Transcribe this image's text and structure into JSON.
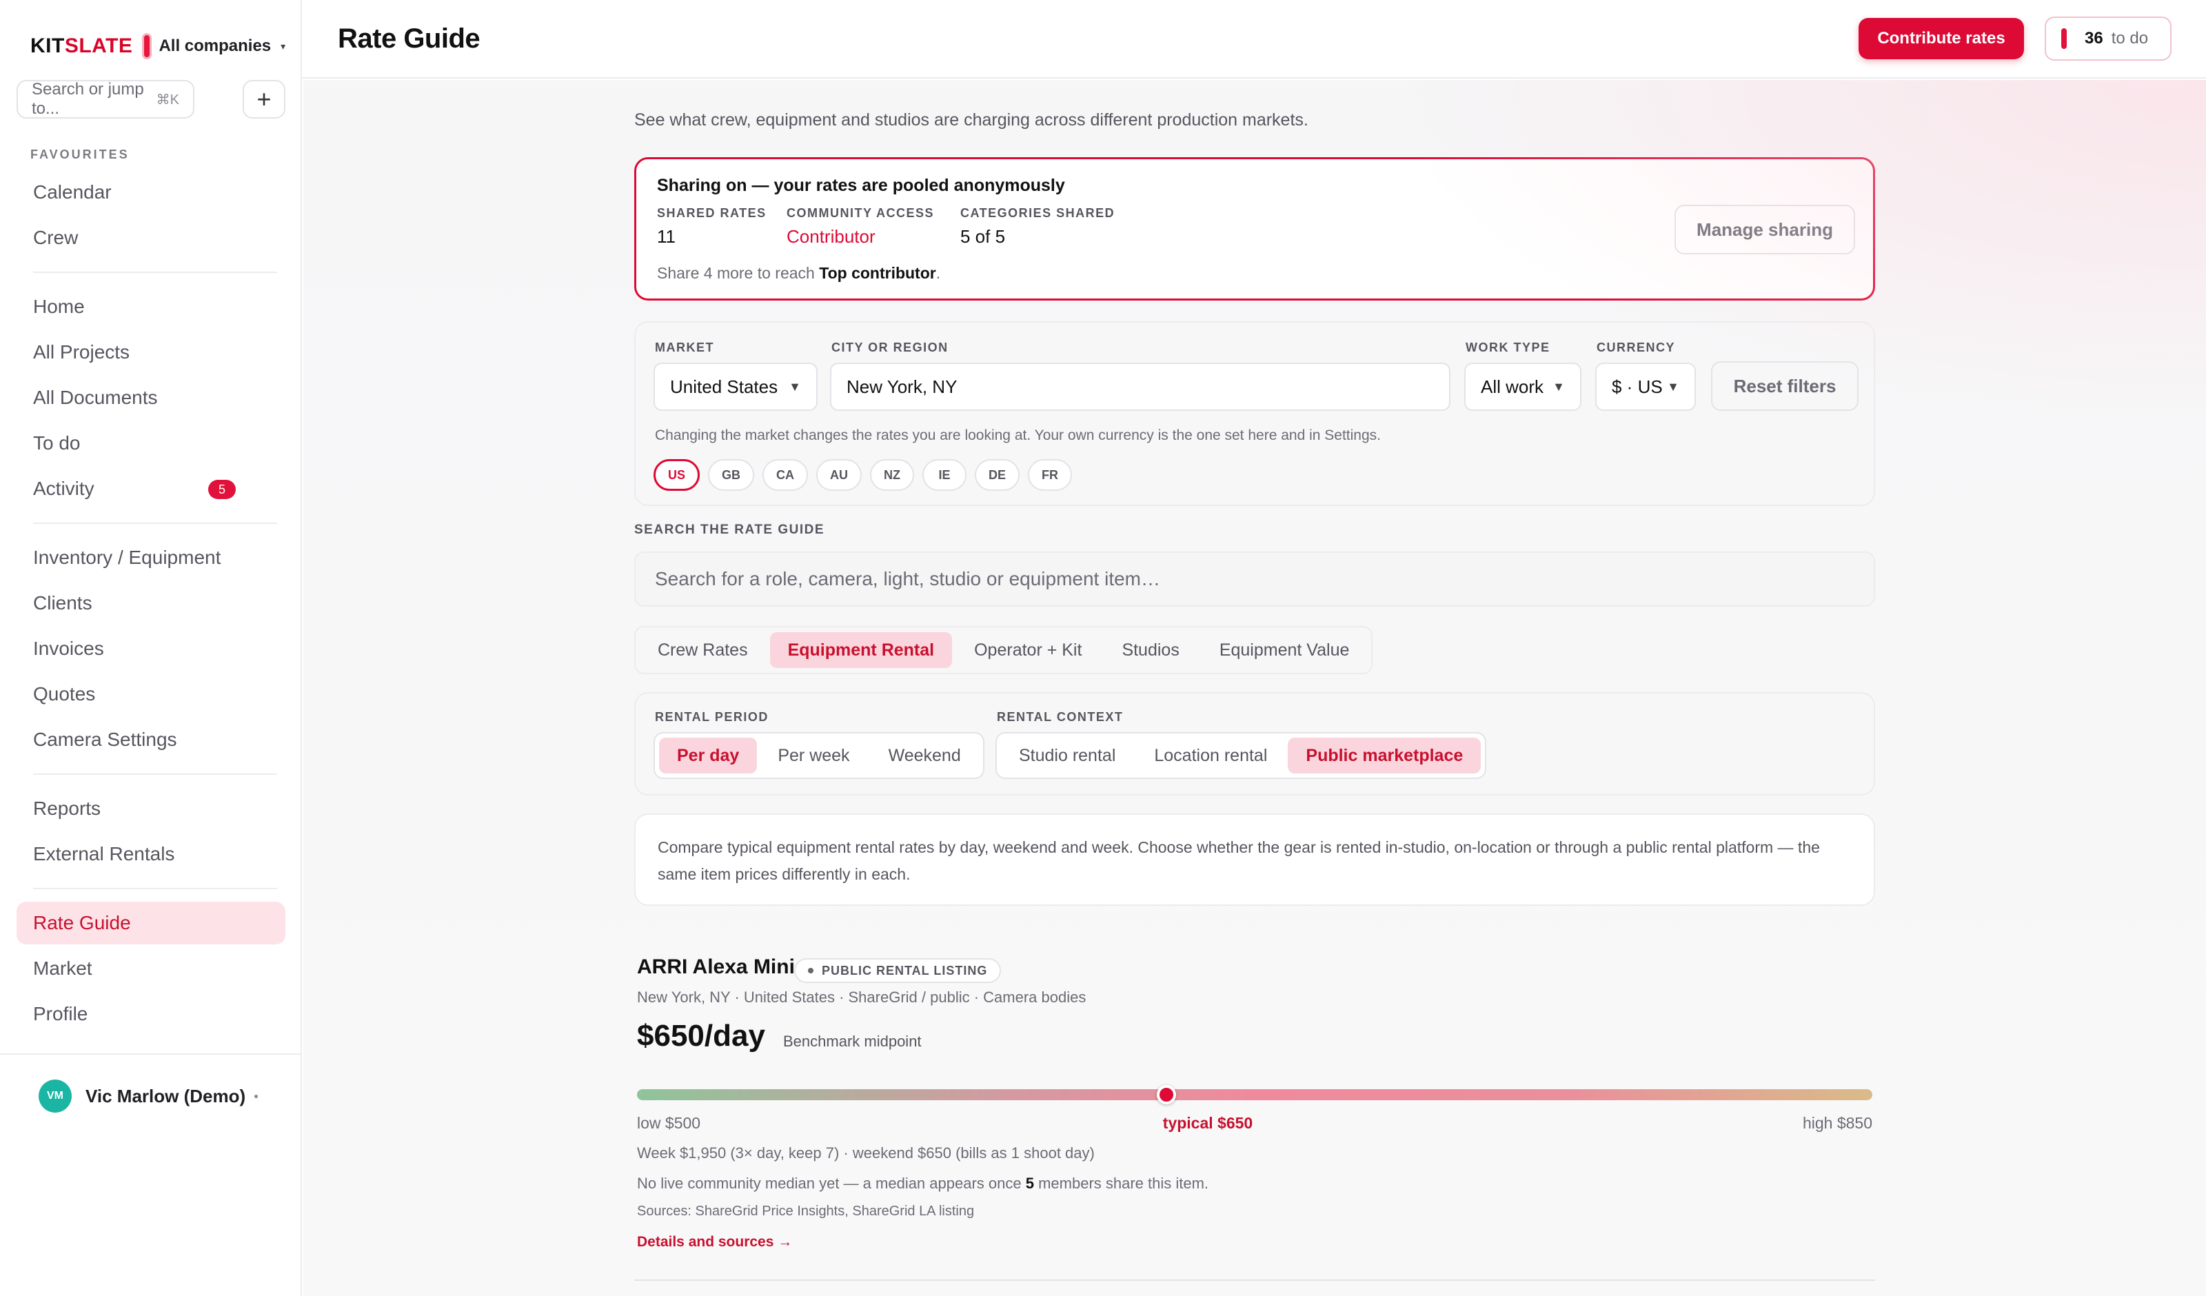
{
  "brand": {
    "name_prefix": "KIT",
    "name_accent": "SLATE",
    "company": "All companies",
    "accent_color": "#d90429"
  },
  "sidebar": {
    "search_placeholder": "Search or jump to...",
    "search_shortcut": "⌘K",
    "add_label": "+",
    "favourites_label": "FAVOURITES",
    "favourites": [
      {
        "label": "Calendar"
      },
      {
        "label": "Crew"
      }
    ],
    "group1": [
      {
        "label": "Home"
      },
      {
        "label": "All Projects"
      },
      {
        "label": "All Documents"
      },
      {
        "label": "To do"
      },
      {
        "label": "Activity",
        "badge": "5"
      }
    ],
    "group2": [
      {
        "label": "Inventory / Equipment"
      },
      {
        "label": "Clients"
      },
      {
        "label": "Invoices"
      },
      {
        "label": "Quotes"
      },
      {
        "label": "Camera Settings"
      }
    ],
    "group3": [
      {
        "label": "Reports"
      },
      {
        "label": "External Rentals"
      }
    ],
    "group4": [
      {
        "label": "Rate Guide",
        "active": true
      },
      {
        "label": "Market"
      },
      {
        "label": "Profile"
      }
    ],
    "user": {
      "initials": "VM",
      "name": "Vic Marlow (Demo)"
    }
  },
  "header": {
    "title": "Rate Guide",
    "contribute_label": "Contribute rates",
    "todo_count": "36",
    "todo_label": "to do"
  },
  "main": {
    "intro": "See what crew, equipment and studios are charging across different production markets.",
    "sharing": {
      "title": "Sharing on — your rates are pooled anonymously",
      "shared_rates_label": "SHARED RATES",
      "shared_rates_value": "11",
      "community_label": "COMMUNITY ACCESS",
      "community_value": "Contributor",
      "categories_label": "CATEGORIES SHARED",
      "categories_value": "5 of 5",
      "share_more_prefix": "Share 4 more to reach ",
      "share_more_target": "Top contributor",
      "share_more_suffix": ".",
      "manage_label": "Manage sharing"
    },
    "filters": {
      "market_label": "MARKET",
      "market_value": "United States",
      "city_label": "CITY OR REGION",
      "city_value": "New York, NY",
      "work_type_label": "WORK TYPE",
      "work_type_value": "All work",
      "currency_label": "CURRENCY",
      "currency_value": "$ · US",
      "reset_label": "Reset filters",
      "note": "Changing the market changes the rates you are looking at. Your own currency is the one set here and in Settings.",
      "countries": [
        "US",
        "GB",
        "CA",
        "AU",
        "NZ",
        "IE",
        "DE",
        "FR"
      ],
      "active_country": "US"
    },
    "search": {
      "label": "SEARCH THE RATE GUIDE",
      "placeholder": "Search for a role, camera, light, studio or equipment item…"
    },
    "tabs": [
      {
        "label": "Crew Rates"
      },
      {
        "label": "Equipment Rental",
        "active": true
      },
      {
        "label": "Operator + Kit"
      },
      {
        "label": "Studios"
      },
      {
        "label": "Equipment Value"
      }
    ],
    "rental_period": {
      "label": "RENTAL PERIOD",
      "options": [
        {
          "label": "Per day",
          "active": true
        },
        {
          "label": "Per week"
        },
        {
          "label": "Weekend"
        }
      ]
    },
    "rental_context": {
      "label": "RENTAL CONTEXT",
      "options": [
        {
          "label": "Studio rental"
        },
        {
          "label": "Location rental"
        },
        {
          "label": "Public marketplace",
          "active": true
        }
      ]
    },
    "description": "Compare typical equipment rental rates by day, weekend and week. Choose whether the gear is rented in-studio, on-location or through a public rental platform — the same item prices differently in each.",
    "item": {
      "title": "ARRI Alexa Mini",
      "tag": "PUBLIC RENTAL LISTING",
      "meta": "New York, NY · United States · ShareGrid / public · Camera bodies",
      "price": "$650/day",
      "price_note": "Benchmark midpoint",
      "range": {
        "low": 500,
        "typical": 650,
        "high": 850
      },
      "low_label": "low $500",
      "typical_label": "typical $650",
      "high_label": "high $850",
      "week_line": "Week $1,950 (3× day, keep 7) · weekend $650 (bills as 1 shoot day)",
      "median_prefix": "No live community median yet — a median appears once ",
      "median_count": "5",
      "median_suffix": " members share this item.",
      "sources": "Sources: ShareGrid Price Insights, ShareGrid LA listing",
      "details_link": "Details and sources →"
    }
  }
}
